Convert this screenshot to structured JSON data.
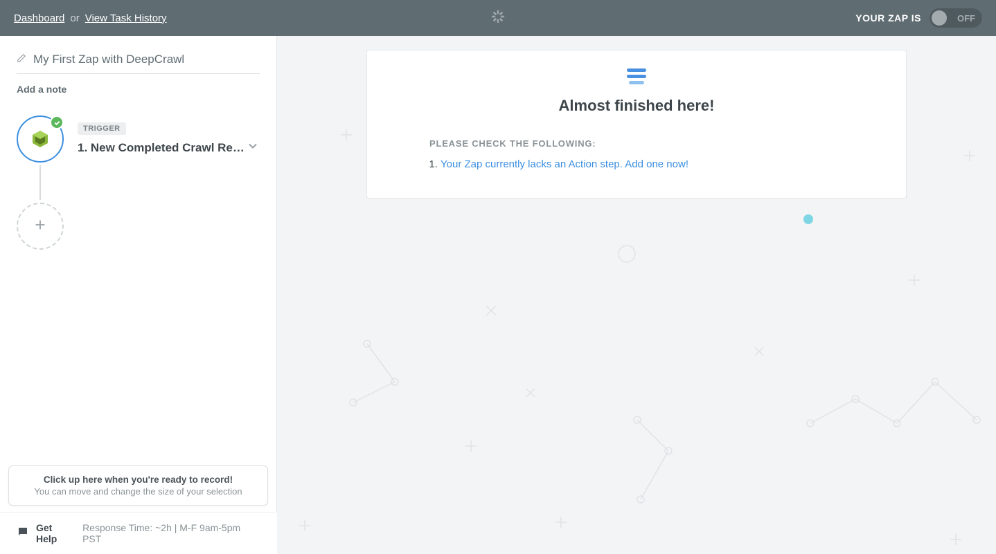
{
  "header": {
    "dashboard": "Dashboard",
    "or": "or",
    "task_history": "View Task History",
    "zap_label": "YOUR ZAP IS",
    "toggle_state": "OFF"
  },
  "sidebar": {
    "title": "My First Zap with DeepCrawl",
    "add_note": "Add a note",
    "trigger_badge": "TRIGGER",
    "step1_title": "1. New Completed Crawl Re…"
  },
  "main": {
    "card_title": "Almost finished here!",
    "check_label": "PLEASE CHECK THE FOLLOWING:",
    "item_prefix": "",
    "item_link": "Your Zap currently lacks an Action step. Add one now!"
  },
  "tooltip": {
    "title": "Click up here when you're ready to record!",
    "sub": "You can move and change the size of your selection"
  },
  "footer": {
    "get_help": "Get Help",
    "meta": "Response Time: ~2h | M-F 9am-5pm PST"
  }
}
